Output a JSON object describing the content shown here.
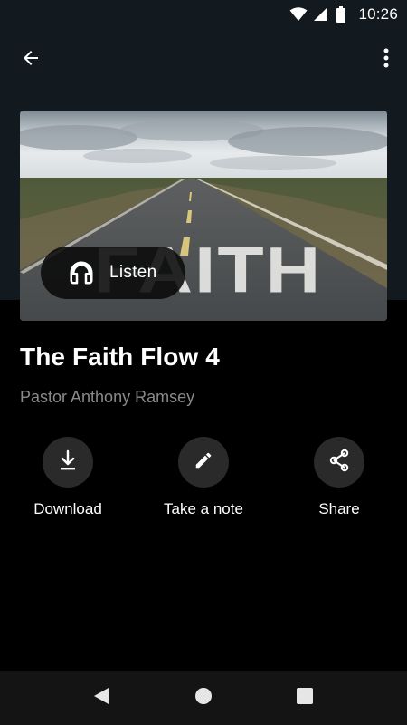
{
  "status_bar": {
    "time": "10:26",
    "icons": [
      "wifi-icon",
      "cellular-signal-icon",
      "battery-icon"
    ]
  },
  "app_bar": {
    "back_icon": "arrow-back-icon",
    "more_icon": "more-vertical-icon"
  },
  "artwork": {
    "text": "FAITH",
    "listen_label": "Listen",
    "listen_icon": "headphones-icon"
  },
  "sermon": {
    "title": "The Faith Flow 4",
    "speaker": "Pastor Anthony Ramsey"
  },
  "actions": [
    {
      "label": "Download",
      "icon": "download-icon"
    },
    {
      "label": "Take a note",
      "icon": "pencil-icon"
    },
    {
      "label": "Share",
      "icon": "share-icon"
    }
  ],
  "nav_bar": {
    "icons": [
      "nav-back-icon",
      "home-icon",
      "recents-icon"
    ]
  },
  "colors": {
    "header_bg": "#121a1f",
    "page_bg": "#000000",
    "action_circle": "#2a2a2a",
    "secondary_text": "#8a8a8a"
  }
}
